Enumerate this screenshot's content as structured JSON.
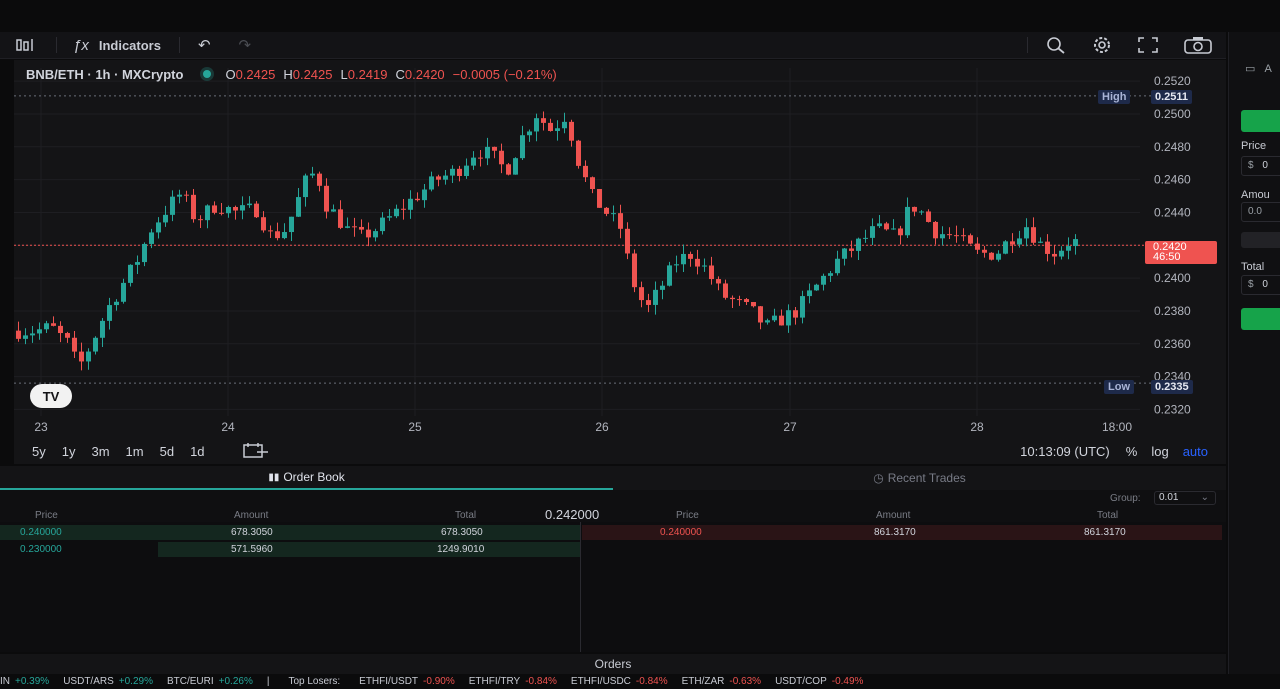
{
  "toolbar": {
    "indicators_label": "Indicators"
  },
  "chart": {
    "symbol": "BNB/ETH · 1h · MXCrypto",
    "ohlc": {
      "o_label": "O",
      "o_value": "0.2425",
      "h_label": "H",
      "h_value": "0.2425",
      "l_label": "L",
      "l_value": "0.2419",
      "c_label": "C",
      "c_value": "0.2420",
      "change": "−0.0005 (−0.21%)"
    },
    "high_label": "High",
    "high_value": "0.2511",
    "low_label": "Low",
    "low_value": "0.2335",
    "current_price": "0.2420",
    "countdown": "46:50",
    "logo_text": "TV",
    "y_ticks": [
      "0.2520",
      "0.2500",
      "0.2480",
      "0.2460",
      "0.2440",
      "0.2420",
      "0.2400",
      "0.2380",
      "0.2360",
      "0.2340",
      "0.2320"
    ],
    "x_ticks": [
      "23",
      "24",
      "25",
      "26",
      "27",
      "28",
      "18:00"
    ],
    "colors": {
      "up": "#26a69a",
      "down": "#ef5350",
      "bg": "#141416",
      "grid": "#1e1e22"
    }
  },
  "chart_data": {
    "type": "candlestick",
    "ylim": [
      0.2316,
      0.2528
    ],
    "x_ticks": [
      "23",
      "24",
      "25",
      "26",
      "27",
      "28",
      "18:00"
    ],
    "candles": []
  },
  "timeframes": [
    "5y",
    "1y",
    "3m",
    "1m",
    "5d",
    "1d"
  ],
  "status": {
    "time": "10:13:09 (UTC)",
    "percent": "%",
    "log": "log",
    "auto": "auto"
  },
  "tabs": {
    "order_book": "Order Book",
    "recent_trades": "Recent Trades"
  },
  "orderbook": {
    "group_label": "Group:",
    "group_value": "0.01",
    "mid_price": "0.242000",
    "bid_headers": [
      "Price",
      "Amount",
      "Total"
    ],
    "ask_headers": [
      "Price",
      "Amount",
      "Total"
    ],
    "bids": [
      {
        "price": "0.240000",
        "amount": "678.3050",
        "total": "678.3050"
      },
      {
        "price": "0.230000",
        "amount": "571.5960",
        "total": "1249.9010"
      }
    ],
    "asks": [
      {
        "price": "0.240000",
        "amount": "861.3170",
        "total": "861.3170"
      }
    ]
  },
  "orders_label": "Orders",
  "ticker": [
    {
      "sym": "IN",
      "chg": "+0.39%",
      "up": true
    },
    {
      "sym": "USDT/ARS",
      "chg": "+0.29%",
      "up": true
    },
    {
      "sym": "BTC/EURI",
      "chg": "+0.26%",
      "up": true
    },
    {
      "sym": "|",
      "chg": "",
      "up": true
    },
    {
      "sym": "Top Losers:",
      "chg": "",
      "up": false
    },
    {
      "sym": "ETHFI/USDT",
      "chg": "-0.90%",
      "up": false
    },
    {
      "sym": "ETHFI/TRY",
      "chg": "-0.84%",
      "up": false
    },
    {
      "sym": "ETHFI/USDC",
      "chg": "-0.84%",
      "up": false
    },
    {
      "sym": "ETH/ZAR",
      "chg": "-0.63%",
      "up": false
    },
    {
      "sym": "USDT/COP",
      "chg": "-0.49%",
      "up": false
    }
  ],
  "sidebar": {
    "tab_label": "A",
    "price_label": "Price",
    "price_prefix": "$",
    "price_value": "0",
    "amount_label": "Amou",
    "amount_value": "0.0",
    "total_label": "Total",
    "total_prefix": "$",
    "total_value": "0"
  }
}
